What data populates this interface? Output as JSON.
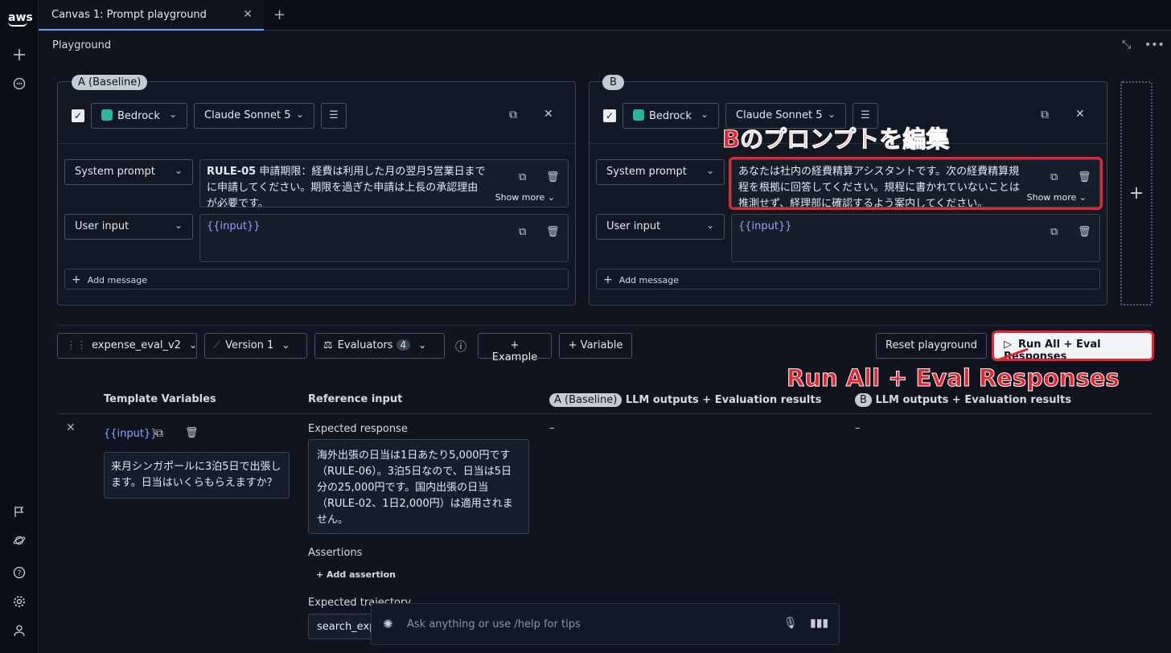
{
  "tab": {
    "label": "Canvas 1: Prompt playground"
  },
  "header": {
    "title": "Playground"
  },
  "panel_a": {
    "badge": "A (Baseline)",
    "provider": "Bedrock",
    "model": "Claude Sonnet 5",
    "system_role": "System prompt",
    "system_text_bold": "RULE-05",
    "system_text": " 申請期限：経費は利用した月の翌月5営業日までに申請してください。期限を過ぎた申請は上長の承認理由が必要です。",
    "show_more": "Show more",
    "user_role": "User input",
    "user_text": "{{input}}",
    "add_message": "Add message"
  },
  "panel_b": {
    "badge": "B",
    "provider": "Bedrock",
    "model": "Claude Sonnet 5",
    "system_role": "System prompt",
    "system_text": "あなたは社内の経費精算アシスタントです。次の経費精算規程を根拠に回答してください。規程に書かれていないことは推測せず、経理部に確認するよう案内してください。",
    "show_more": "Show more",
    "user_role": "User input",
    "user_text": "{{input}}",
    "add_message": "Add message"
  },
  "toolbar": {
    "dataset": "expense_eval_v2",
    "version": "Version 1",
    "evaluators": "Evaluators",
    "evaluator_count": "4",
    "example": "+ Example",
    "variable": "+ Variable",
    "reset": "Reset playground",
    "run": "Run All + Eval Responses"
  },
  "table": {
    "col_template": "Template Variables",
    "col_reference": "Reference input",
    "col_a_badge": "A (Baseline)",
    "col_a": " LLM outputs + Evaluation results",
    "col_b_badge": "B",
    "col_b": " LLM outputs + Evaluation results",
    "var_name": "{{input}}",
    "var_value": "来月シンガポールに3泊5日で出張します。日当はいくらもらえますか？",
    "expected_label": "Expected response",
    "expected_text": "海外出張の日当は1日あたり5,000円です（RULE-06）。3泊5日なので、日当は5日分の25,000円です。国内出張の日当（RULE-02、1日2,000円）は適用されません。",
    "assertions_label": "Assertions",
    "add_assertion": "+ Add assertion",
    "trajectory_label": "Expected trajectory",
    "trajectory_value": "search_exp",
    "a_output": "–",
    "b_output": "–"
  },
  "annotations": {
    "edit_b": "Bのプロンプトを編集",
    "run_all": "Run All + Eval Responses",
    "color": "#e3262f"
  },
  "chat": {
    "placeholder": "Ask anything or use  /help for tips"
  }
}
